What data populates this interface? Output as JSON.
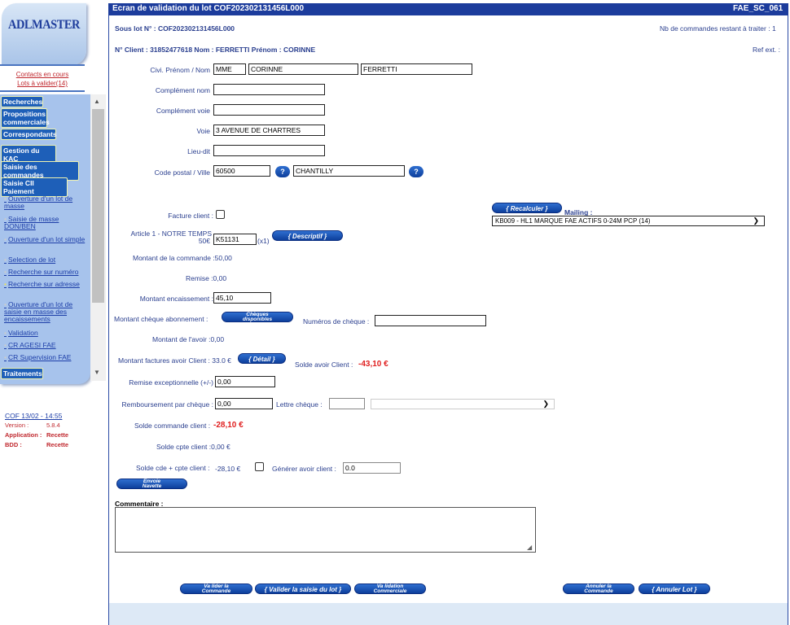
{
  "sidebar": {
    "logo": "ADLMASTER",
    "links": [
      "Contacts en cours",
      "Lots à valider(14)"
    ],
    "menu": [
      "Recherches",
      "Propositions commerciales",
      "Correspondants",
      "Gestion du KAC",
      "Saisie des commandes",
      "Saisie CII Paiement"
    ],
    "submenu": [
      "Ouverture d'un lot de masse",
      "Saisie de masse DON/BEN",
      "Ouverture d'un lot simple",
      "Selection de lot",
      "Recherche sur numéro",
      "Recherche sur adresse",
      "Ouverture d'un lot de saisie en masse des encaissements",
      "Validation",
      "CR AGESI FAE",
      "CR Supervision FAE"
    ],
    "last_menu": "Traitements",
    "version_link": "COF 13/02 - 14:55",
    "info": [
      {
        "k": "Version :",
        "v": "5.8.4"
      },
      {
        "k": "Application :",
        "v": "Recette"
      },
      {
        "k": "BDD :",
        "v": "Recette"
      }
    ]
  },
  "header": {
    "title": "Ecran de validation du lot COF202302131456L000",
    "code": "FAE_SC_061"
  },
  "lot": {
    "sous_lot": "Sous lot N° : COF202302131456L000",
    "remaining": "Nb de commandes restant à traiter : 1"
  },
  "client": {
    "line": "N° Client : 31852477618 Nom : FERRETTI Prénom : CORINNE",
    "ref_ext": "Ref ext. :"
  },
  "form": {
    "civ_label": "Civi. Prénom / Nom",
    "civ": "MME",
    "prenom": "CORINNE",
    "nom": "FERRETTI",
    "complement_nom_label": "Complément nom",
    "complement_voie_label": "Complément voie",
    "voie_label": "Voie",
    "voie": "3 AVENUE DE CHARTRES",
    "lieu_dit_label": "Lieu-dit",
    "cp_label": "Code postal / Ville",
    "cp": "60500",
    "ville": "CHANTILLY",
    "help": "?",
    "facture_label": "Facture client :",
    "recalculer": "{ Recalculer }",
    "mailing_label": "Mailing :",
    "mailing_value": "KB009 - HL1 MARQUE FAE ACTIFS 0-24M PCP (14)",
    "article_label_1": "Article 1 - NOTRE TEMPS",
    "article_label_2": "50€",
    "article_code": "K51131",
    "article_qty": "(x1)",
    "descriptif": "{ Descriptif }",
    "montant_commande": "Montant de la commande :50,00",
    "remise": "Remise :0,00",
    "montant_enc_label": "Montant encaissement :",
    "montant_enc": "45,10",
    "cheque_abo_label": "Montant chèque abonnement :",
    "cheques_btn_1": "Chèques",
    "cheques_btn_2": "disponibles",
    "num_cheque_label": "Numéros de chèque :",
    "avoir": "Montant de l'avoir :0,00",
    "factures_avoir_label": "Montant factures avoir Client : 33.0 €",
    "detail_btn": "{ Détail }",
    "solde_avoir_label": "Solde avoir Client :",
    "solde_avoir": "-43,10 €",
    "remise_exc_label": "Remise exceptionnelle (+/-)",
    "remise_exc": "0,00",
    "remb_label": "Remboursement par chèque :",
    "remb": "0,00",
    "lettre_label": "Lettre chèque :",
    "solde_cmd_label": "Solde commande client :",
    "solde_cmd": "-28,10 €",
    "solde_cpte": "Solde cpte client :0,00 €",
    "solde_cde_cpte_label": "Solde cde + cpte client :",
    "solde_cde_cpte": "-28,10 €",
    "generer_label": "Générer avoir client :",
    "generer": "0.0",
    "envoie_1": "Envoie",
    "envoie_2": "Navette",
    "commentaire_label": "Commentaire :"
  },
  "footer": {
    "valider_cmd_1": "Va lider la",
    "valider_cmd_2": "Commande",
    "valider_saisie": "{ Valider la saisie du lot }",
    "valider_com_1": "Va lidation",
    "valider_com_2": "Commerciale",
    "annuler_cmd_1": "Annuler la",
    "annuler_cmd_2": "Commande",
    "annuler_lot": "{ Annuler Lot }"
  }
}
